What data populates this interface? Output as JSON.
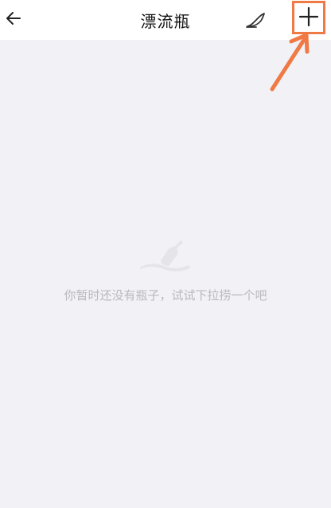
{
  "header": {
    "title": "漂流瓶",
    "back_icon": "back-arrow-icon",
    "write_icon": "pen-icon",
    "add_icon": "plus-icon"
  },
  "empty_state": {
    "icon": "bottle-icon",
    "message": "你暂时还没有瓶子，试试下拉捞一个吧"
  },
  "annotation": {
    "highlight_color": "#f07a45"
  },
  "colors": {
    "background": "#f2f2f6",
    "header_bg": "#ffffff",
    "placeholder_text": "#b9b9bd"
  }
}
